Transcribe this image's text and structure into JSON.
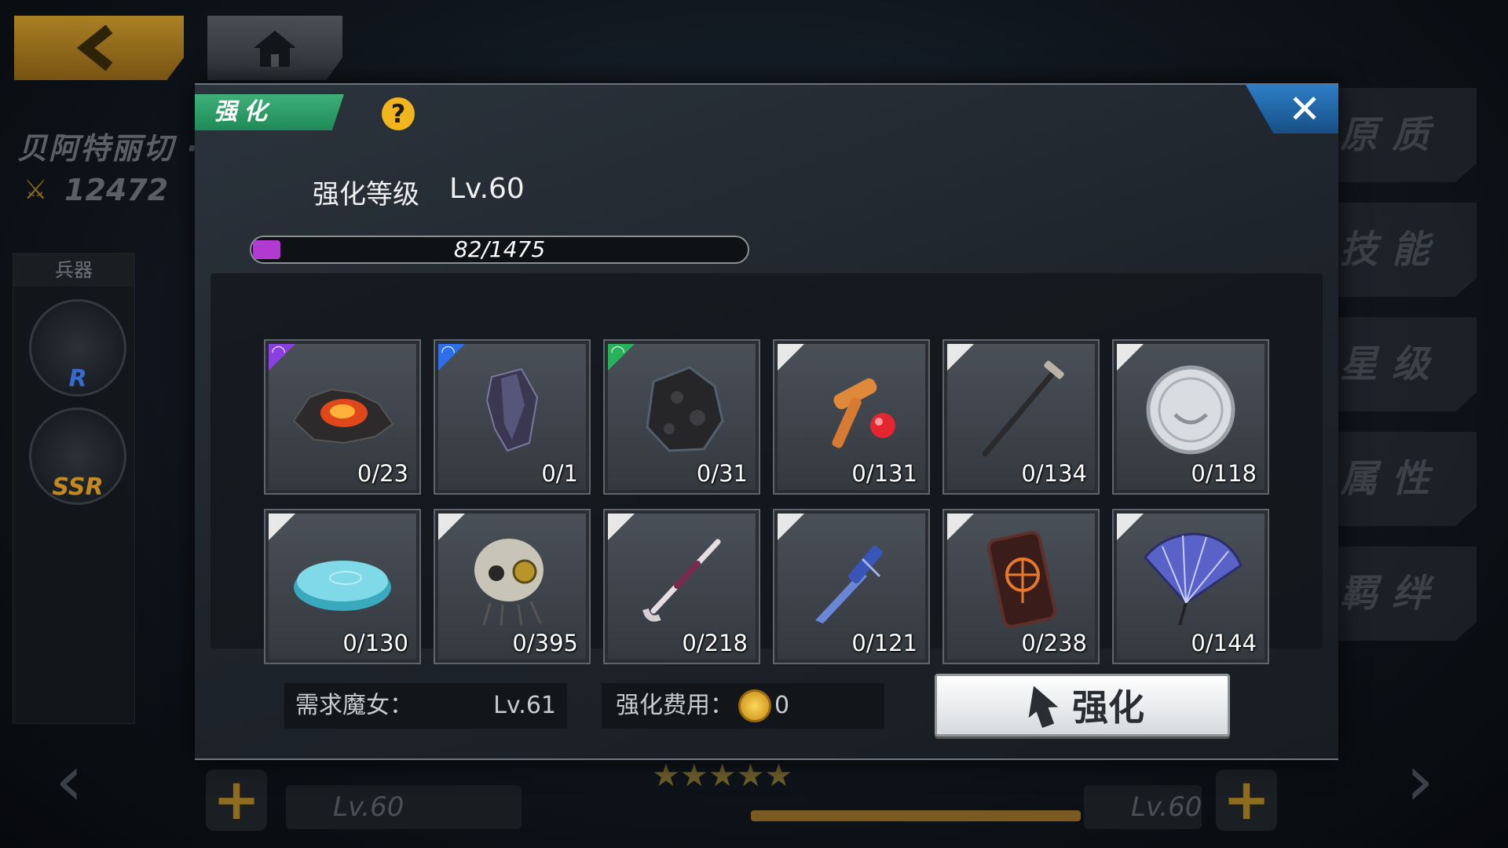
{
  "background": {
    "character_name": "贝阿特丽切 · 波尔蒂纳",
    "power": "12472",
    "weapon_panel_title": "兵器",
    "weapon_slots": [
      {
        "rank": "R",
        "color": "#3a6ad0"
      },
      {
        "rank": "SSR",
        "color": "#c48a20"
      }
    ],
    "right_tabs": [
      "原质",
      "技能",
      "星级",
      "属性",
      "羁绊"
    ],
    "left_level": "Lv.60",
    "right_level": "Lv.60",
    "stars": "★★★★★"
  },
  "modal": {
    "tab_label": "强化",
    "help_icon": "question-icon",
    "close_icon": "close-icon",
    "level_label": "强化等级",
    "level_value": "Lv.60",
    "progress": {
      "current": 82,
      "max": 1475,
      "text": "82/1475"
    },
    "items": [
      {
        "name": "molten-ore",
        "rarity": "purple",
        "count": "0/23"
      },
      {
        "name": "dark-crystal",
        "rarity": "blue",
        "count": "0/1"
      },
      {
        "name": "meteorite-stone",
        "rarity": "green",
        "count": "0/31"
      },
      {
        "name": "kendama-toy",
        "rarity": "white",
        "count": "0/131"
      },
      {
        "name": "walking-cane",
        "rarity": "white",
        "count": "0/134"
      },
      {
        "name": "silver-coin",
        "rarity": "white",
        "count": "0/118"
      },
      {
        "name": "soap-bar",
        "rarity": "white",
        "count": "0/130"
      },
      {
        "name": "mechanical-skull",
        "rarity": "white",
        "count": "0/395"
      },
      {
        "name": "smoking-pipe",
        "rarity": "white",
        "count": "0/218"
      },
      {
        "name": "butterfly-knife",
        "rarity": "white",
        "count": "0/121"
      },
      {
        "name": "rune-tablet",
        "rarity": "white",
        "count": "0/238"
      },
      {
        "name": "folding-fan",
        "rarity": "white",
        "count": "0/144"
      }
    ],
    "requirement": {
      "label": "需求魔女：",
      "value": "Lv.61"
    },
    "cost": {
      "label": "强化费用：",
      "value": "0"
    },
    "enhance_button": "强化"
  }
}
